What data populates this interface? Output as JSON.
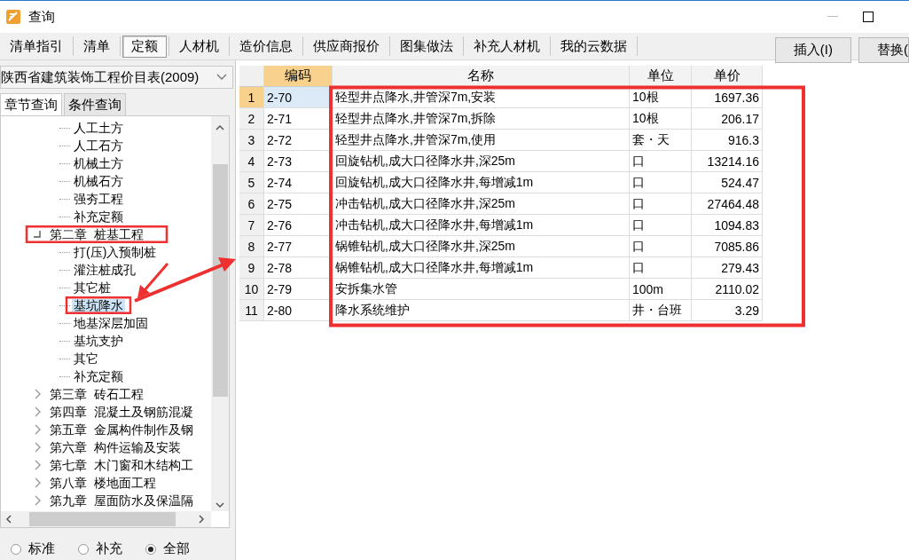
{
  "window": {
    "title": "查询"
  },
  "toolbar_tabs": [
    {
      "label": "清单指引",
      "selected": false
    },
    {
      "label": "清单",
      "selected": false
    },
    {
      "label": "定额",
      "selected": true
    },
    {
      "label": "人材机",
      "selected": false
    },
    {
      "label": "造价信息",
      "selected": false
    },
    {
      "label": "供应商报价",
      "selected": false
    },
    {
      "label": "图集做法",
      "selected": false
    },
    {
      "label": "补充人材机",
      "selected": false
    },
    {
      "label": "我的云数据",
      "selected": false
    }
  ],
  "action_buttons": [
    "插入(I)",
    "替换("
  ],
  "library_dropdown": {
    "value": "陕西省建筑装饰工程价目表(2009)"
  },
  "query_tabs": [
    {
      "label": "章节查询",
      "selected": true
    },
    {
      "label": "条件查询",
      "selected": false
    }
  ],
  "tree": {
    "previous_chapter_items": [
      {
        "label": "人工土方",
        "selected": false
      },
      {
        "label": "人工石方",
        "selected": false
      },
      {
        "label": "机械土方",
        "selected": false
      },
      {
        "label": "机械石方",
        "selected": false
      },
      {
        "label": "强夯工程",
        "selected": false
      },
      {
        "label": "补充定额",
        "selected": false
      }
    ],
    "chapters": [
      {
        "label": "第二章  桩基工程",
        "expanded": true,
        "children": [
          {
            "label": "打(压)入预制桩",
            "selected": false
          },
          {
            "label": "灌注桩成孔",
            "selected": false
          },
          {
            "label": "其它桩",
            "selected": false
          },
          {
            "label": "基坑降水",
            "selected": true
          },
          {
            "label": "地基深层加固",
            "selected": false
          },
          {
            "label": "基坑支护",
            "selected": false
          },
          {
            "label": "其它",
            "selected": false
          },
          {
            "label": "补充定额",
            "selected": false
          }
        ]
      },
      {
        "label": "第三章  砖石工程",
        "expanded": false
      },
      {
        "label": "第四章  混凝土及钢筋混凝",
        "expanded": false
      },
      {
        "label": "第五章  金属构件制作及钢",
        "expanded": false
      },
      {
        "label": "第六章  构件运输及安装",
        "expanded": false
      },
      {
        "label": "第七章  木门窗和木结构工",
        "expanded": false
      },
      {
        "label": "第八章  楼地面工程",
        "expanded": false
      },
      {
        "label": "第九章  屋面防水及保温隔",
        "expanded": false
      }
    ]
  },
  "filter_radios": [
    {
      "label": "标准",
      "selected": false
    },
    {
      "label": "补充",
      "selected": false
    },
    {
      "label": "全部",
      "selected": true
    }
  ],
  "table": {
    "columns": [
      "编码",
      "名称",
      "单位",
      "单价"
    ],
    "rows": [
      {
        "index": "1",
        "code": "2-70",
        "name": "轻型井点降水,井管深7m,安装",
        "unit": "10根",
        "price": "1697.36",
        "selected": true
      },
      {
        "index": "2",
        "code": "2-71",
        "name": "轻型井点降水,井管深7m,拆除",
        "unit": "10根",
        "price": "206.17",
        "selected": false
      },
      {
        "index": "3",
        "code": "2-72",
        "name": "轻型井点降水,井管深7m,使用",
        "unit": "套・天",
        "price": "916.3",
        "selected": false
      },
      {
        "index": "4",
        "code": "2-73",
        "name": "回旋钻机,成大口径降水井,深25m",
        "unit": "口",
        "price": "13214.16",
        "selected": false
      },
      {
        "index": "5",
        "code": "2-74",
        "name": "回旋钻机,成大口径降水井,每增减1m",
        "unit": "口",
        "price": "524.47",
        "selected": false
      },
      {
        "index": "6",
        "code": "2-75",
        "name": "冲击钻机,成大口径降水井,深25m",
        "unit": "口",
        "price": "27464.48",
        "selected": false
      },
      {
        "index": "7",
        "code": "2-76",
        "name": "冲击钻机,成大口径降水井,每增减1m",
        "unit": "口",
        "price": "1094.83",
        "selected": false
      },
      {
        "index": "8",
        "code": "2-77",
        "name": "锅锥钻机,成大口径降水井,深25m",
        "unit": "口",
        "price": "7085.86",
        "selected": false
      },
      {
        "index": "9",
        "code": "2-78",
        "name": "锅锥钻机,成大口径降水井,每增减1m",
        "unit": "口",
        "price": "279.43",
        "selected": false
      },
      {
        "index": "10",
        "code": "2-79",
        "name": "安拆集水管",
        "unit": "100m",
        "price": "2110.02",
        "selected": false
      },
      {
        "index": "11",
        "code": "2-80",
        "name": "降水系统维护",
        "unit": "井・台班",
        "price": "3.29",
        "selected": false
      }
    ]
  }
}
